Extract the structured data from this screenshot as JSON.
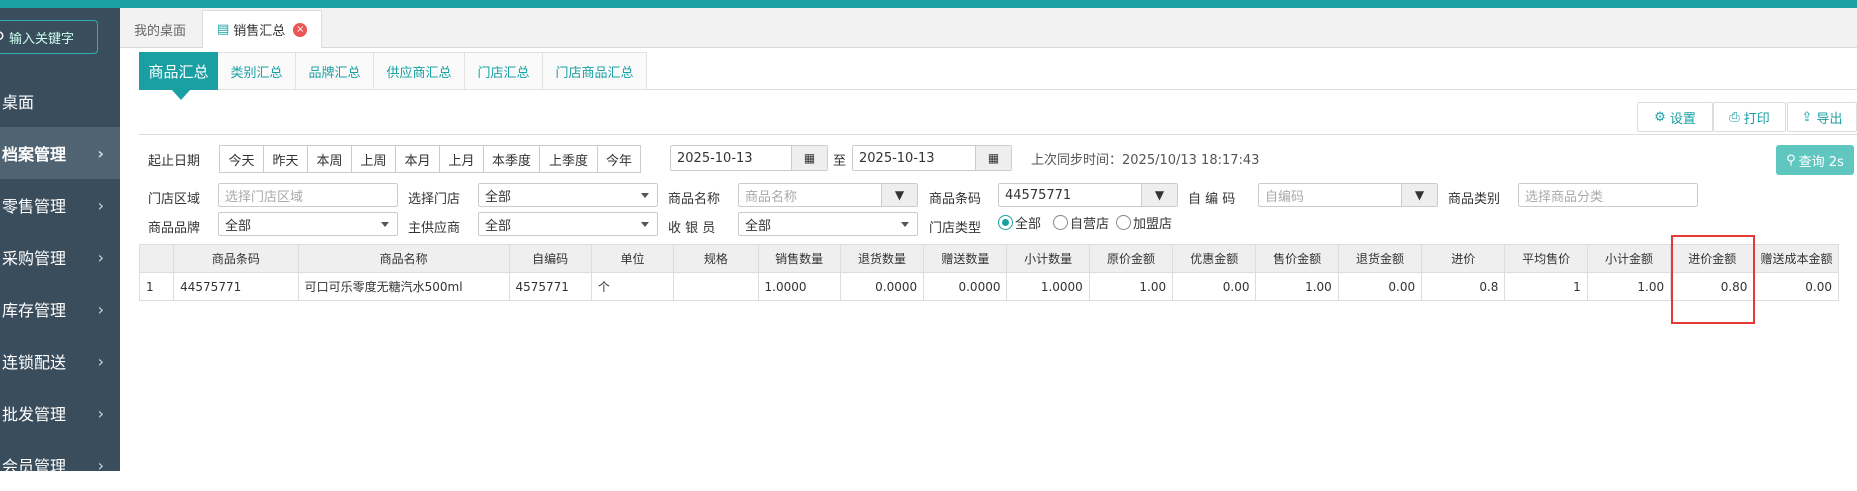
{
  "sidebar": {
    "search_placeholder": "输入关键字",
    "items": [
      {
        "label": "桌面",
        "chev": ""
      },
      {
        "label": "档案管理",
        "chev": "›"
      },
      {
        "label": "零售管理",
        "chev": "›"
      },
      {
        "label": "采购管理",
        "chev": "›"
      },
      {
        "label": "库存管理",
        "chev": "›"
      },
      {
        "label": "连锁配送",
        "chev": "›"
      },
      {
        "label": "批发管理",
        "chev": "›"
      },
      {
        "label": "会员管理",
        "chev": "›"
      }
    ]
  },
  "tabs": {
    "home": "我的桌面",
    "active": "销售汇总",
    "close": "×"
  },
  "subtabs": [
    "商品汇总",
    "类别汇总",
    "品牌汇总",
    "供应商汇总",
    "门店汇总",
    "门店商品汇总"
  ],
  "toolbar": {
    "settings": "设置",
    "print": "打印",
    "export": "导出"
  },
  "filters": {
    "date_label": "起止日期",
    "quick": [
      "今天",
      "昨天",
      "本周",
      "上周",
      "本月",
      "上月",
      "本季度",
      "上季度",
      "今年"
    ],
    "start_date": "2025-10-13",
    "to": "至",
    "end_date": "2025-10-13",
    "sync_label": "上次同步时间：2025/10/13 18:17:43",
    "query_button": "查询 2s",
    "store_area_label": "门店区域",
    "store_area_ph": "选择门店区域",
    "store_label": "选择门店",
    "store_value": "全部",
    "name_label": "商品名称",
    "name_ph": "商品名称",
    "barcode_label": "商品条码",
    "barcode_value": "44575771",
    "selfcode_label": "自 编 码",
    "selfcode_ph": "自编码",
    "category_label": "商品类别",
    "category_ph": "选择商品分类",
    "brand_label": "商品品牌",
    "brand_value": "全部",
    "supplier_label": "主供应商",
    "supplier_value": "全部",
    "cashier_label": "收 银 员",
    "cashier_value": "全部",
    "store_type_label": "门店类型",
    "store_types": [
      "全部",
      "自营店",
      "加盟店"
    ],
    "store_type_selected": "全部"
  },
  "table": {
    "columns": [
      "",
      "商品条码",
      "商品名称",
      "自编码",
      "单位",
      "规格",
      "销售数量",
      "退货数量",
      "赠送数量",
      "小计数量",
      "原价金额",
      "优惠金额",
      "售价金额",
      "退货金额",
      "进价",
      "平均售价",
      "小计金额",
      "进价金额",
      "赠送成本金额"
    ],
    "rows": [
      [
        "1",
        "44575771",
        "可口可乐零度无糖汽水500ml",
        "4575771",
        "个",
        "",
        "1.0000",
        "0.0000",
        "0.0000",
        "1.0000",
        "1.00",
        "0.00",
        "1.00",
        "0.00",
        "0.8",
        "1",
        "1.00",
        "0.80",
        "0.00"
      ]
    ]
  },
  "colors": {
    "accent": "#1aa0a3",
    "sidebar": "#3a4d5c",
    "highlight": "#e53935"
  }
}
